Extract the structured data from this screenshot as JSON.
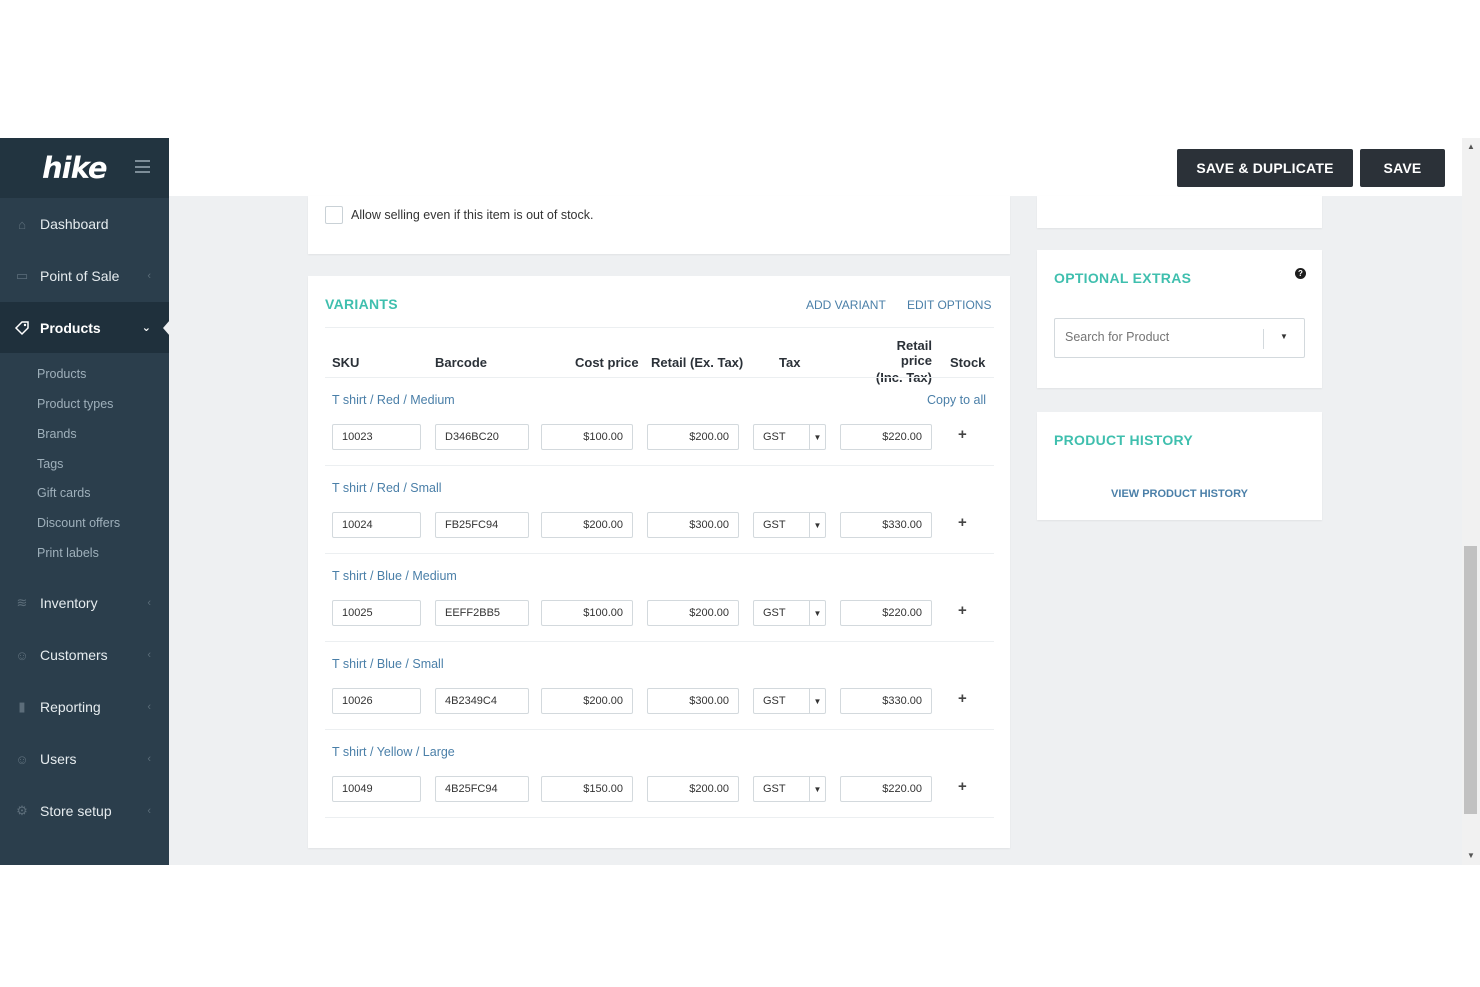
{
  "sidebar": {
    "logo": "hike",
    "nav": [
      {
        "label": "Dashboard",
        "icon": "home-icon"
      },
      {
        "label": "Point of Sale",
        "icon": "register-icon"
      },
      {
        "label": "Products",
        "icon": "tag-icon",
        "active": true
      },
      {
        "label": "Inventory",
        "icon": "stack-icon"
      },
      {
        "label": "Customers",
        "icon": "user-group-icon"
      },
      {
        "label": "Reporting",
        "icon": "bar-chart-icon"
      },
      {
        "label": "Users",
        "icon": "user-icon"
      },
      {
        "label": "Store setup",
        "icon": "gear-icon"
      }
    ],
    "sub_items": [
      "Products",
      "Product types",
      "Brands",
      "Tags",
      "Gift cards",
      "Discount offers",
      "Print labels"
    ]
  },
  "header": {
    "save_duplicate_label": "SAVE & DUPLICATE",
    "save_label": "SAVE"
  },
  "stock_card": {
    "allow_selling_label": "Allow selling even if this item is out of stock."
  },
  "variants": {
    "title": "VARIANTS",
    "add_variant": "ADD VARIANT",
    "edit_options": "EDIT OPTIONS",
    "columns": {
      "sku": "SKU",
      "barcode": "Barcode",
      "cost_price": "Cost price",
      "retail_ex": "Retail (Ex. Tax)",
      "tax": "Tax",
      "retail_inc_line1": "Retail price",
      "retail_inc_line2": "(Inc. Tax)",
      "stock": "Stock"
    },
    "copy_to_all": "Copy to all",
    "rows": [
      {
        "name": "T shirt / Red / Medium",
        "sku": "10023",
        "barcode": "D346BC20",
        "cost": "$100.00",
        "retail_ex": "$200.00",
        "tax": "GST",
        "retail_inc": "$220.00"
      },
      {
        "name": "T shirt / Red / Small",
        "sku": "10024",
        "barcode": "FB25FC94",
        "cost": "$200.00",
        "retail_ex": "$300.00",
        "tax": "GST",
        "retail_inc": "$330.00"
      },
      {
        "name": "T shirt / Blue / Medium",
        "sku": "10025",
        "barcode": "EEFF2BB5",
        "cost": "$100.00",
        "retail_ex": "$200.00",
        "tax": "GST",
        "retail_inc": "$220.00"
      },
      {
        "name": "T shirt / Blue / Small",
        "sku": "10026",
        "barcode": "4B2349C4",
        "cost": "$200.00",
        "retail_ex": "$300.00",
        "tax": "GST",
        "retail_inc": "$330.00"
      },
      {
        "name": "T shirt / Yellow / Large",
        "sku": "10049",
        "barcode": "4B25FC94",
        "cost": "$150.00",
        "retail_ex": "$200.00",
        "tax": "GST",
        "retail_inc": "$220.00"
      }
    ]
  },
  "optional_extras": {
    "title": "OPTIONAL EXTRAS",
    "search_placeholder": "Search for Product"
  },
  "product_history": {
    "title": "PRODUCT HISTORY",
    "view_link": "VIEW PRODUCT HISTORY"
  },
  "colors": {
    "sidebar": "#2b3e4c",
    "accent_teal": "#3fbfae",
    "link_blue": "#4a7fa8",
    "button_dark": "#2b3138"
  }
}
